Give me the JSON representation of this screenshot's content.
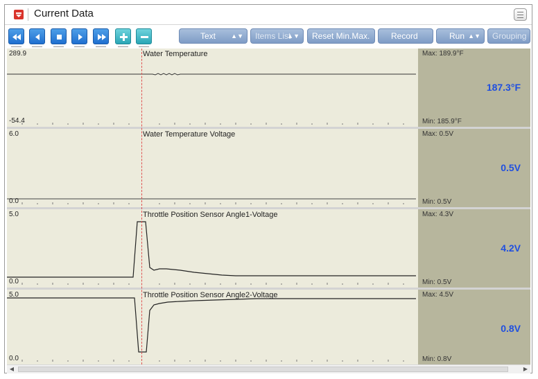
{
  "window": {
    "title": "Current Data",
    "app_icon": "down-arrow-icon",
    "menu_icon": "menu-list-icon"
  },
  "toolbar": {
    "nav_buttons": [
      {
        "icon": "rewind-icon"
      },
      {
        "icon": "step-back-icon"
      },
      {
        "icon": "stop-icon"
      },
      {
        "icon": "play-icon"
      },
      {
        "icon": "fast-forward-icon"
      },
      {
        "icon": "plus-icon"
      },
      {
        "icon": "minus-icon"
      }
    ],
    "text_btn": "Text",
    "items_list_btn": "Items List",
    "reset_btn": "Reset Min.Max.",
    "record_btn": "Record",
    "run_btn": "Run",
    "grouping_btn": "Grouping"
  },
  "panes": [
    {
      "title": "Water Temperature",
      "y_max": "289.9",
      "y_min": "-54.4",
      "max_label": "Max: 189.9°F",
      "min_label": "Min: 185.9°F",
      "current": "187.3°F"
    },
    {
      "title": "Water Temperature Voltage",
      "y_max": "6.0",
      "y_min": "0.0",
      "max_label": "Max:  0.5V",
      "min_label": "Min:  0.5V",
      "current": "0.5V"
    },
    {
      "title": "Throttle Position Sensor Angle1-Voltage",
      "y_max": "5.0",
      "y_min": "0.0",
      "max_label": "Max:  4.3V",
      "min_label": "Min:  0.5V",
      "current": "4.2V"
    },
    {
      "title": "Throttle Position Sensor Angle2-Voltage",
      "y_max": "5.0",
      "y_min": "0.0",
      "max_label": "Max:  4.5V",
      "min_label": "Min:  0.8V",
      "current": "0.8V"
    }
  ],
  "colors": {
    "plot_bg": "#ecebdc",
    "value_bg": "#b7b69d",
    "value_text": "#1f4fe0",
    "cursor": "#e05050",
    "accent_blue": "#1f6fcf"
  }
}
